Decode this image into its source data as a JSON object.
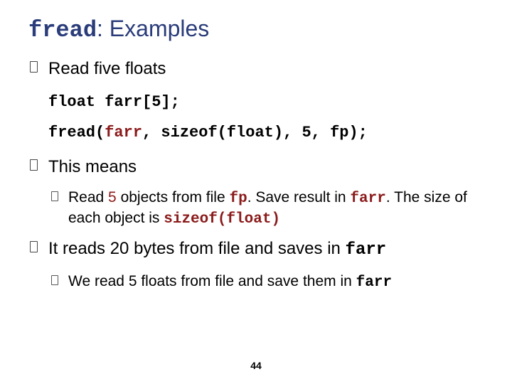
{
  "title": {
    "mono": "fread",
    "rest": ": Examples"
  },
  "bullets": {
    "b1": "Read five floats",
    "code1": {
      "line1": "float farr[5];",
      "line2_a": "fread(",
      "line2_b": "farr",
      "line2_c": ", sizeof(float), 5, fp);"
    },
    "b2": "This means",
    "b2a": {
      "t1": "Read ",
      "t2": "5",
      "t3": " objects from file ",
      "t4": "fp",
      "t5": ". Save result in ",
      "t6": "farr",
      "t7": ". The size of each object is ",
      "t8": "sizeof(float)"
    },
    "b3": {
      "t1": "It reads 20 bytes from file and saves in ",
      "t2": "farr"
    },
    "b3a": {
      "t1": "We read 5 floats from file and save them in ",
      "t2": "farr"
    }
  },
  "page_number": "44"
}
